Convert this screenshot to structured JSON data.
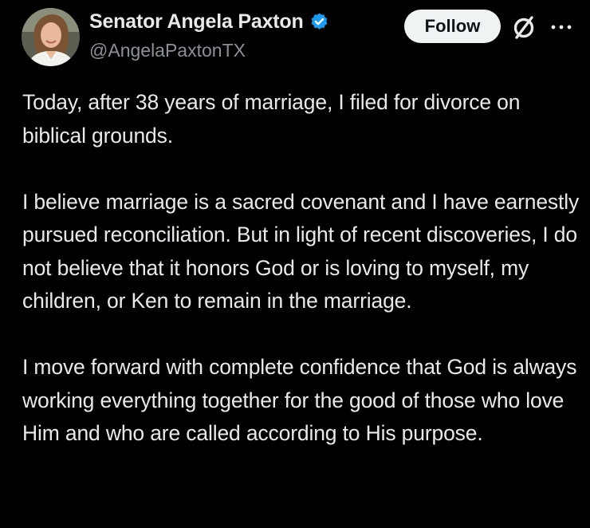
{
  "post": {
    "author": {
      "display_name": "Senator Angela Paxton",
      "handle": "@AngelaPaxtonTX",
      "verified": true,
      "verified_color": "#1d9bf0"
    },
    "actions": {
      "follow_label": "Follow",
      "null_icon": "empty-set-icon",
      "more_icon": "more-horizontal-icon"
    },
    "paragraphs": [
      "Today, after 38 years of marriage, I filed for divorce on biblical grounds.",
      "I believe marriage is a sacred covenant and I have earnestly pursued reconciliation. But in light of recent discoveries, I do not believe that it honors God or is loving to myself, my children, or Ken to remain in the marriage.",
      "I move forward with complete confidence that God is always working everything together for the good of those who love Him and who are called according to His purpose."
    ]
  },
  "colors": {
    "background": "#000000",
    "text_primary": "#e7e9ea",
    "text_secondary": "#8b9197",
    "button_bg": "#eff3f4",
    "button_text": "#0f1419"
  }
}
